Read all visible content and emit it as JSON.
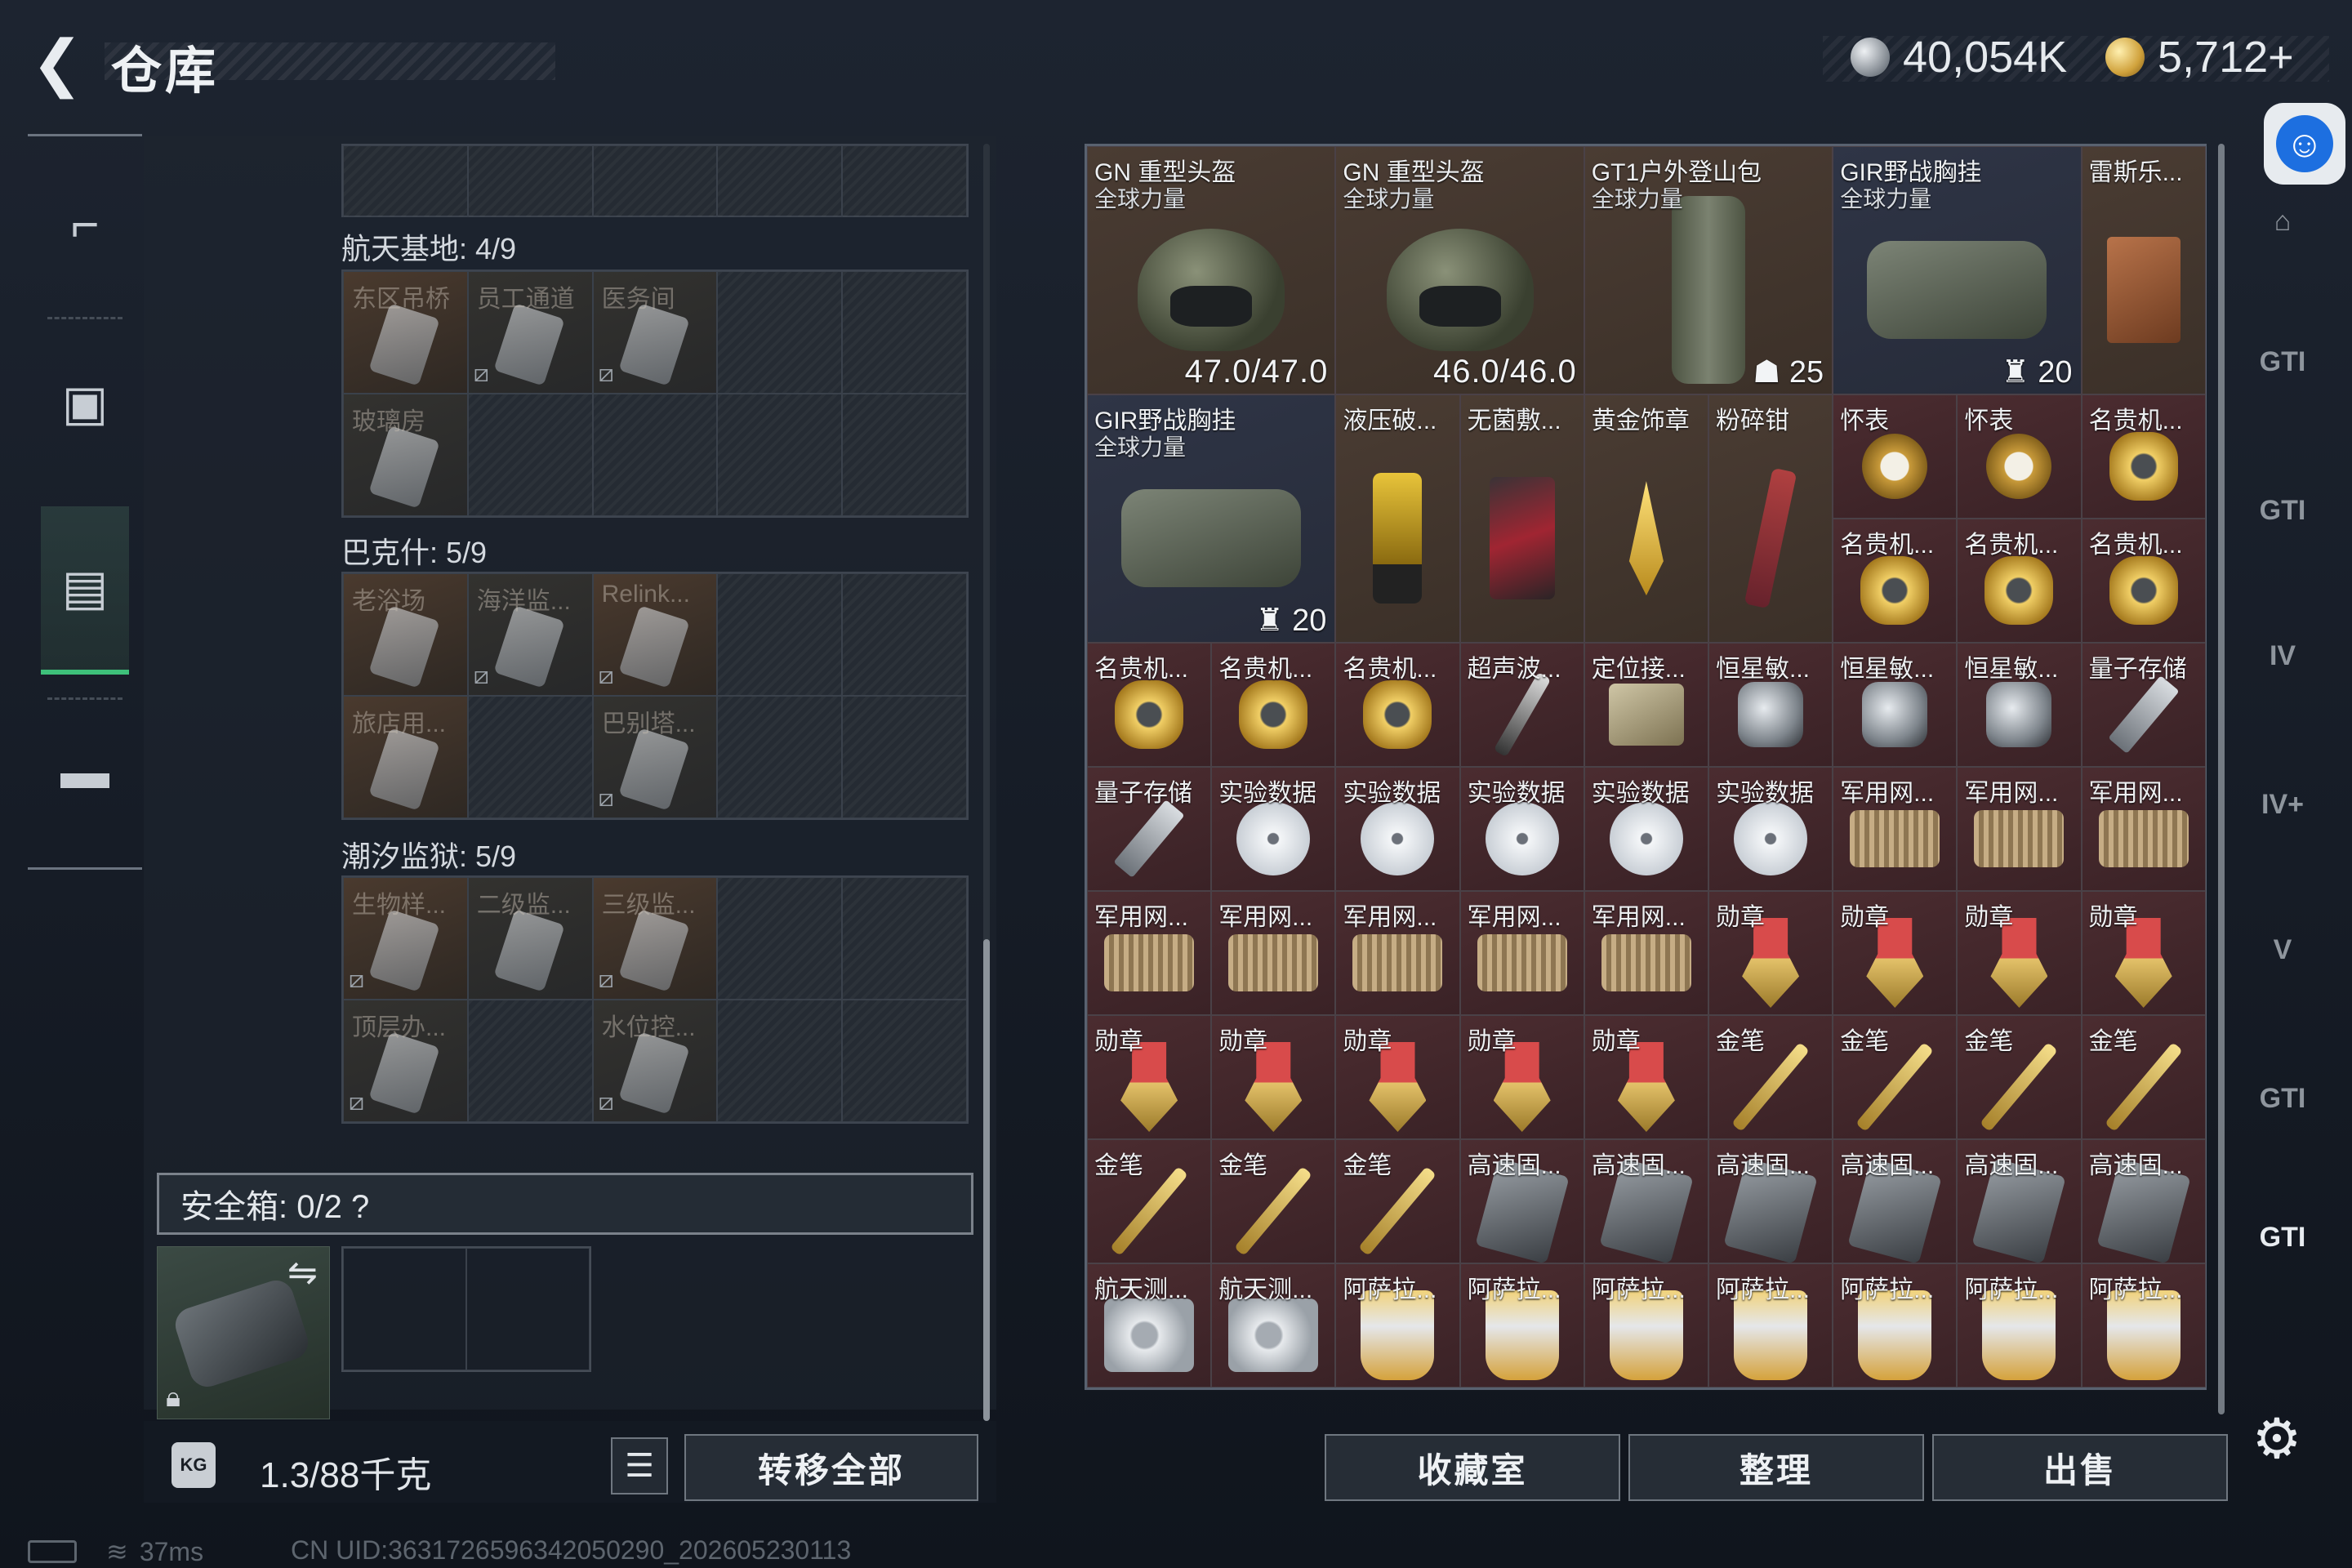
{
  "header": {
    "title": "仓库",
    "currency_silver": "40,054K",
    "currency_gold": "5,712+"
  },
  "left_nav": [
    {
      "name": "weapon",
      "icon": "pistol-icon"
    },
    {
      "name": "gear",
      "icon": "backpack-icon"
    },
    {
      "name": "storage",
      "icon": "container-icon",
      "active": true
    },
    {
      "name": "kit",
      "icon": "briefcase-icon"
    }
  ],
  "sections": [
    {
      "title": "航天基地: 4/9",
      "slots": [
        {
          "label": "东区吊桥",
          "type": "key"
        },
        {
          "label": "员工通道",
          "type": "keydim",
          "nolink": true
        },
        {
          "label": "医务间",
          "type": "keydim",
          "nolink": true
        },
        {
          "label": "",
          "type": "empty"
        },
        {
          "label": "",
          "type": "empty"
        },
        {
          "label": "玻璃房",
          "type": "keydim"
        },
        {
          "label": "",
          "type": "empty"
        },
        {
          "label": "",
          "type": "empty"
        },
        {
          "label": "",
          "type": "empty"
        },
        {
          "label": "",
          "type": "empty"
        }
      ]
    },
    {
      "title": "巴克什: 5/9",
      "slots": [
        {
          "label": "老浴场",
          "type": "key"
        },
        {
          "label": "海洋监...",
          "type": "keydim",
          "nolink": true
        },
        {
          "label": "Relink...",
          "type": "key",
          "nolink": true
        },
        {
          "label": "",
          "type": "empty"
        },
        {
          "label": "",
          "type": "empty"
        },
        {
          "label": "旅店用...",
          "type": "key"
        },
        {
          "label": "",
          "type": "empty"
        },
        {
          "label": "巴别塔...",
          "type": "keydim",
          "nolink": true
        },
        {
          "label": "",
          "type": "empty"
        },
        {
          "label": "",
          "type": "empty"
        }
      ]
    },
    {
      "title": "潮汐监狱: 5/9",
      "slots": [
        {
          "label": "生物样...",
          "type": "key",
          "nolink": true
        },
        {
          "label": "二级监...",
          "type": "keydim"
        },
        {
          "label": "三级监...",
          "type": "key",
          "nolink": true
        },
        {
          "label": "",
          "type": "empty"
        },
        {
          "label": "",
          "type": "empty"
        },
        {
          "label": "顶层办...",
          "type": "keydim",
          "nolink": true
        },
        {
          "label": "",
          "type": "empty"
        },
        {
          "label": "水位控...",
          "type": "keydim",
          "nolink": true
        },
        {
          "label": "",
          "type": "empty"
        },
        {
          "label": "",
          "type": "empty"
        }
      ]
    }
  ],
  "safe_box": {
    "label": "安全箱: 0/2 ?"
  },
  "footer_left": {
    "weight": "1.3/88千克",
    "weight_icon_text": "KG",
    "transfer_label": "转移全部"
  },
  "storage_items": [
    {
      "name": "GN 重型头盔",
      "sub": "全球力量",
      "icon": "helmet",
      "dura": "47.0/47.0",
      "bg": "brown",
      "col": 0,
      "row": 0,
      "w": 2,
      "h": 2
    },
    {
      "name": "GN 重型头盔",
      "sub": "全球力量",
      "icon": "helmet",
      "dura": "46.0/46.0",
      "bg": "brown",
      "col": 2,
      "row": 0,
      "w": 2,
      "h": 2
    },
    {
      "name": "GT1户外登山包",
      "sub": "全球力量",
      "icon": "pack",
      "count": "25",
      "count_icon": "bag",
      "bg": "brown",
      "col": 4,
      "row": 0,
      "w": 2,
      "h": 2
    },
    {
      "name": "GIR野战胸挂",
      "sub": "全球力量",
      "icon": "vest",
      "count": "20",
      "count_icon": "vest",
      "bg": "blue",
      "col": 6,
      "row": 0,
      "w": 2,
      "h": 2
    },
    {
      "name": "雷斯乐...",
      "icon": "book",
      "bg": "brown",
      "col": 8,
      "row": 0,
      "w": 1,
      "h": 2
    },
    {
      "name": "GIR野战胸挂",
      "sub": "全球力量",
      "icon": "vest",
      "count": "20",
      "count_icon": "vest",
      "bg": "blue",
      "col": 0,
      "row": 2,
      "w": 2,
      "h": 2
    },
    {
      "name": "液压破...",
      "icon": "jack",
      "bg": "brown",
      "col": 2,
      "row": 2,
      "w": 1,
      "h": 2
    },
    {
      "name": "无菌敷...",
      "icon": "pouch",
      "bg": "brown",
      "col": 3,
      "row": 2,
      "w": 1,
      "h": 2
    },
    {
      "name": "黄金饰章",
      "icon": "badge",
      "bg": "brown",
      "col": 4,
      "row": 2,
      "w": 1,
      "h": 2
    },
    {
      "name": "粉碎钳",
      "icon": "plier",
      "bg": "brown",
      "col": 5,
      "row": 2,
      "w": 1,
      "h": 2
    },
    {
      "name": "怀表",
      "icon": "watch",
      "bg": "red",
      "col": 6,
      "row": 2,
      "w": 1,
      "h": 1
    },
    {
      "name": "怀表",
      "icon": "watch",
      "bg": "red",
      "col": 7,
      "row": 2,
      "w": 1,
      "h": 1
    },
    {
      "name": "名贵机...",
      "icon": "gwatch",
      "bg": "red",
      "col": 8,
      "row": 2,
      "w": 1,
      "h": 1
    },
    {
      "name": "名贵机...",
      "icon": "gwatch",
      "bg": "red",
      "col": 6,
      "row": 3,
      "w": 1,
      "h": 1
    },
    {
      "name": "名贵机...",
      "icon": "gwatch",
      "bg": "red",
      "col": 7,
      "row": 3,
      "w": 1,
      "h": 1
    },
    {
      "name": "名贵机...",
      "icon": "gwatch",
      "bg": "red",
      "col": 8,
      "row": 3,
      "w": 1,
      "h": 1
    },
    {
      "name": "名贵机...",
      "icon": "gwatch",
      "bg": "red",
      "col": 0,
      "row": 4,
      "w": 1,
      "h": 1
    },
    {
      "name": "名贵机...",
      "icon": "gwatch",
      "bg": "red",
      "col": 1,
      "row": 4,
      "w": 1,
      "h": 1
    },
    {
      "name": "名贵机...",
      "icon": "gwatch",
      "bg": "red",
      "col": 2,
      "row": 4,
      "w": 1,
      "h": 1
    },
    {
      "name": "超声波...",
      "icon": "pen",
      "bg": "red",
      "col": 3,
      "row": 4,
      "w": 1,
      "h": 1
    },
    {
      "name": "定位接...",
      "icon": "board",
      "bg": "red",
      "col": 4,
      "row": 4,
      "w": 1,
      "h": 1
    },
    {
      "name": "恒星敏...",
      "icon": "lens",
      "bg": "red",
      "col": 5,
      "row": 4,
      "w": 1,
      "h": 1
    },
    {
      "name": "恒星敏...",
      "icon": "lens",
      "bg": "red",
      "col": 6,
      "row": 4,
      "w": 1,
      "h": 1
    },
    {
      "name": "恒星敏...",
      "icon": "lens",
      "bg": "red",
      "col": 7,
      "row": 4,
      "w": 1,
      "h": 1
    },
    {
      "name": "量子存储",
      "icon": "usb",
      "bg": "red",
      "col": 8,
      "row": 4,
      "w": 1,
      "h": 1
    },
    {
      "name": "量子存储",
      "icon": "usb",
      "bg": "red",
      "col": 0,
      "row": 5,
      "w": 1,
      "h": 1
    },
    {
      "name": "实验数据",
      "icon": "disc",
      "bg": "red",
      "col": 1,
      "row": 5,
      "w": 1,
      "h": 1
    },
    {
      "name": "实验数据",
      "icon": "disc",
      "bg": "red",
      "col": 2,
      "row": 5,
      "w": 1,
      "h": 1
    },
    {
      "name": "实验数据",
      "icon": "disc",
      "bg": "red",
      "col": 3,
      "row": 5,
      "w": 1,
      "h": 1
    },
    {
      "name": "实验数据",
      "icon": "disc",
      "bg": "red",
      "col": 4,
      "row": 5,
      "w": 1,
      "h": 1
    },
    {
      "name": "实验数据",
      "icon": "disc",
      "bg": "red",
      "col": 5,
      "row": 5,
      "w": 1,
      "h": 1
    },
    {
      "name": "军用网...",
      "icon": "router",
      "bg": "red",
      "col": 6,
      "row": 5,
      "w": 1,
      "h": 1
    },
    {
      "name": "军用网...",
      "icon": "router",
      "bg": "red",
      "col": 7,
      "row": 5,
      "w": 1,
      "h": 1
    },
    {
      "name": "军用网...",
      "icon": "router",
      "bg": "red",
      "col": 8,
      "row": 5,
      "w": 1,
      "h": 1
    },
    {
      "name": "军用网...",
      "icon": "router",
      "bg": "red",
      "col": 0,
      "row": 6,
      "w": 1,
      "h": 1
    },
    {
      "name": "军用网...",
      "icon": "router",
      "bg": "red",
      "col": 1,
      "row": 6,
      "w": 1,
      "h": 1
    },
    {
      "name": "军用网...",
      "icon": "router",
      "bg": "red",
      "col": 2,
      "row": 6,
      "w": 1,
      "h": 1
    },
    {
      "name": "军用网...",
      "icon": "router",
      "bg": "red",
      "col": 3,
      "row": 6,
      "w": 1,
      "h": 1
    },
    {
      "name": "军用网...",
      "icon": "router",
      "bg": "red",
      "col": 4,
      "row": 6,
      "w": 1,
      "h": 1
    },
    {
      "name": "勋章",
      "icon": "medal",
      "bg": "red",
      "col": 5,
      "row": 6,
      "w": 1,
      "h": 1
    },
    {
      "name": "勋章",
      "icon": "medal",
      "bg": "red",
      "col": 6,
      "row": 6,
      "w": 1,
      "h": 1
    },
    {
      "name": "勋章",
      "icon": "medal",
      "bg": "red",
      "col": 7,
      "row": 6,
      "w": 1,
      "h": 1
    },
    {
      "name": "勋章",
      "icon": "medal",
      "bg": "red",
      "col": 8,
      "row": 6,
      "w": 1,
      "h": 1
    },
    {
      "name": "勋章",
      "icon": "medal",
      "bg": "red",
      "col": 0,
      "row": 7,
      "w": 1,
      "h": 1
    },
    {
      "name": "勋章",
      "icon": "medal",
      "bg": "red",
      "col": 1,
      "row": 7,
      "w": 1,
      "h": 1
    },
    {
      "name": "勋章",
      "icon": "medal",
      "bg": "red",
      "col": 2,
      "row": 7,
      "w": 1,
      "h": 1
    },
    {
      "name": "勋章",
      "icon": "medal",
      "bg": "red",
      "col": 3,
      "row": 7,
      "w": 1,
      "h": 1
    },
    {
      "name": "勋章",
      "icon": "medal",
      "bg": "red",
      "col": 4,
      "row": 7,
      "w": 1,
      "h": 1
    },
    {
      "name": "金笔",
      "icon": "goldpen",
      "bg": "red",
      "col": 5,
      "row": 7,
      "w": 1,
      "h": 1
    },
    {
      "name": "金笔",
      "icon": "goldpen",
      "bg": "red",
      "col": 6,
      "row": 7,
      "w": 1,
      "h": 1
    },
    {
      "name": "金笔",
      "icon": "goldpen",
      "bg": "red",
      "col": 7,
      "row": 7,
      "w": 1,
      "h": 1
    },
    {
      "name": "金笔",
      "icon": "goldpen",
      "bg": "red",
      "col": 8,
      "row": 7,
      "w": 1,
      "h": 1
    },
    {
      "name": "金笔",
      "icon": "goldpen",
      "bg": "red",
      "col": 0,
      "row": 8,
      "w": 1,
      "h": 1
    },
    {
      "name": "金笔",
      "icon": "goldpen",
      "bg": "red",
      "col": 1,
      "row": 8,
      "w": 1,
      "h": 1
    },
    {
      "name": "金笔",
      "icon": "goldpen",
      "bg": "red",
      "col": 2,
      "row": 8,
      "w": 1,
      "h": 1
    },
    {
      "name": "高速固...",
      "icon": "ssd",
      "bg": "red",
      "col": 3,
      "row": 8,
      "w": 1,
      "h": 1
    },
    {
      "name": "高速固...",
      "icon": "ssd",
      "bg": "red",
      "col": 4,
      "row": 8,
      "w": 1,
      "h": 1
    },
    {
      "name": "高速固...",
      "icon": "ssd",
      "bg": "red",
      "col": 5,
      "row": 8,
      "w": 1,
      "h": 1
    },
    {
      "name": "高速固...",
      "icon": "ssd",
      "bg": "red",
      "col": 6,
      "row": 8,
      "w": 1,
      "h": 1
    },
    {
      "name": "高速固...",
      "icon": "ssd",
      "bg": "red",
      "col": 7,
      "row": 8,
      "w": 1,
      "h": 1
    },
    {
      "name": "高速固...",
      "icon": "ssd",
      "bg": "red",
      "col": 8,
      "row": 8,
      "w": 1,
      "h": 1
    },
    {
      "name": "航天测...",
      "icon": "hdd",
      "bg": "red",
      "col": 0,
      "row": 9,
      "w": 1,
      "h": 1
    },
    {
      "name": "航天测...",
      "icon": "hdd",
      "bg": "red",
      "col": 1,
      "row": 9,
      "w": 1,
      "h": 1
    },
    {
      "name": "阿萨拉...",
      "icon": "cup",
      "bg": "red",
      "col": 2,
      "row": 9,
      "w": 1,
      "h": 1
    },
    {
      "name": "阿萨拉...",
      "icon": "cup",
      "bg": "red",
      "col": 3,
      "row": 9,
      "w": 1,
      "h": 1
    },
    {
      "name": "阿萨拉...",
      "icon": "cup",
      "bg": "red",
      "col": 4,
      "row": 9,
      "w": 1,
      "h": 1
    },
    {
      "name": "阿萨拉...",
      "icon": "cup",
      "bg": "red",
      "col": 5,
      "row": 9,
      "w": 1,
      "h": 1
    },
    {
      "name": "阿萨拉...",
      "icon": "cup",
      "bg": "red",
      "col": 6,
      "row": 9,
      "w": 1,
      "h": 1
    },
    {
      "name": "阿萨拉...",
      "icon": "cup",
      "bg": "red",
      "col": 7,
      "row": 9,
      "w": 1,
      "h": 1
    },
    {
      "name": "阿萨拉...",
      "icon": "cup",
      "bg": "red",
      "col": 8,
      "row": 9,
      "w": 1,
      "h": 1
    }
  ],
  "footer_right": {
    "collection_label": "收藏室",
    "sort_label": "整理",
    "sell_label": "出售"
  },
  "right_nav": [
    {
      "label": "⌂",
      "icon": "home-icon"
    },
    {
      "label": "GTI",
      "icon": "filter-gti-icon"
    },
    {
      "label": "GTI",
      "icon": "filter-gti-2-icon"
    },
    {
      "label": "IV",
      "icon": "filter-iv-icon"
    },
    {
      "label": "IV+",
      "icon": "filter-iv-plus-icon"
    },
    {
      "label": "V",
      "icon": "filter-v-icon"
    },
    {
      "label": "GTI",
      "icon": "filter-gti-3-icon"
    },
    {
      "label": "GTI",
      "icon": "filter-gti-4-icon",
      "active": true
    }
  ],
  "status_bar": {
    "ping": "37ms",
    "uid": "CN UID:363172659634205029​0_202605230113"
  }
}
